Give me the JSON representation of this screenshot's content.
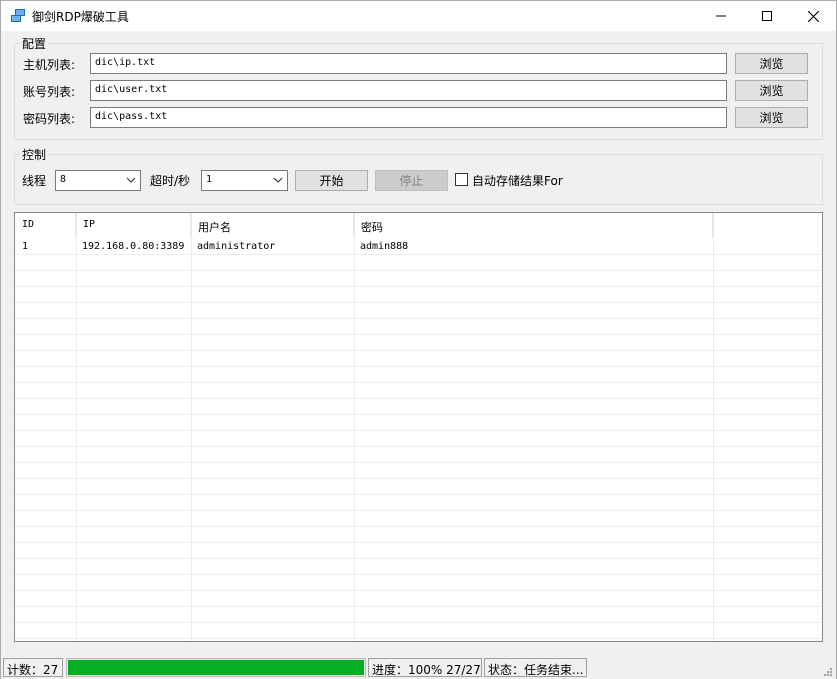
{
  "window": {
    "title": "御剑RDP爆破工具",
    "controls": {
      "minimize": "minimize-icon",
      "maximize": "maximize-icon",
      "close": "close-icon"
    }
  },
  "config": {
    "legend": "配置",
    "rows": [
      {
        "label": "主机列表:",
        "value": "dic\\ip.txt",
        "browse": "浏览"
      },
      {
        "label": "账号列表:",
        "value": "dic\\user.txt",
        "browse": "浏览"
      },
      {
        "label": "密码列表:",
        "value": "dic\\pass.txt",
        "browse": "浏览"
      }
    ]
  },
  "control": {
    "legend": "控制",
    "threads_label": "线程",
    "threads_value": "8",
    "timeout_label": "超时/秒",
    "timeout_value": "1",
    "start_label": "开始",
    "stop_label": "停止",
    "autosave_label": "自动存储结果For",
    "autosave_checked": false
  },
  "results": {
    "columns": [
      "ID",
      "IP",
      "用户名",
      "密码"
    ],
    "rows": [
      {
        "id": "1",
        "ip": "192.168.0.80:3389",
        "user": "administrator",
        "password": "admin888"
      }
    ]
  },
  "status": {
    "count": "计数：27",
    "progress_fraction": 1.0,
    "progress_text": "进度：100% 27/27",
    "state": "状态：任务结束..."
  },
  "colors": {
    "progress_fill": "#06b025",
    "app_icon": "#1e6fb8"
  }
}
